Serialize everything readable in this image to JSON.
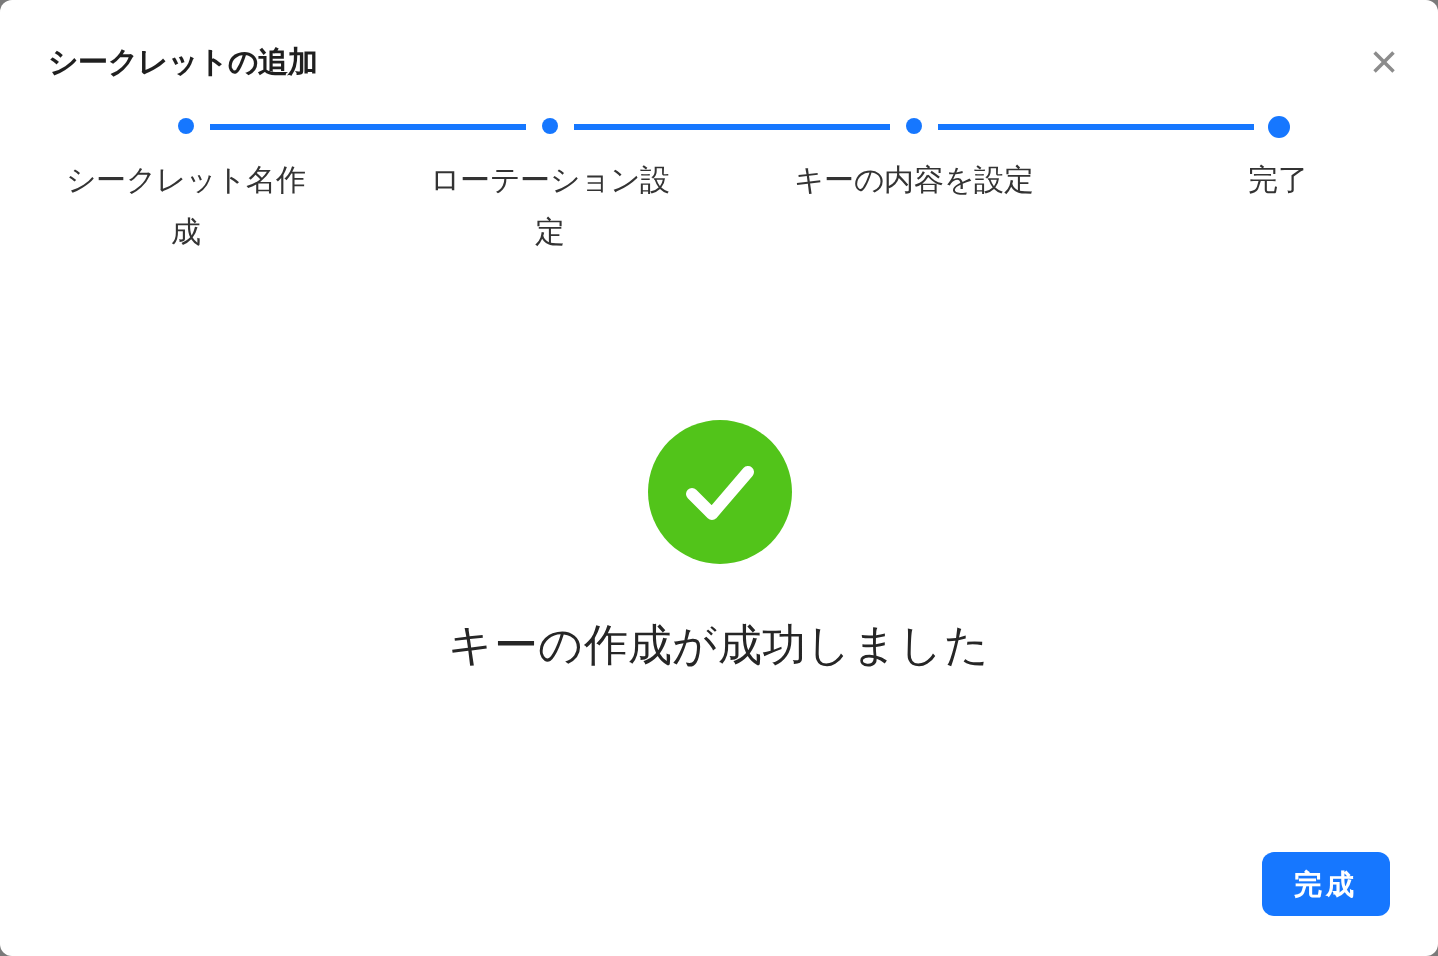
{
  "dialog": {
    "title": "シークレットの追加",
    "close": "×"
  },
  "steps": [
    {
      "label": "シークレット名作成",
      "done": true,
      "selected": false
    },
    {
      "label": "ローテーション設定",
      "done": true,
      "selected": false
    },
    {
      "label": "キーの内容を設定",
      "done": true,
      "selected": false
    },
    {
      "label": "完了",
      "done": false,
      "selected": true
    }
  ],
  "result": {
    "kind": "success",
    "message": "キーの作成が成功しました"
  },
  "buttons": [
    {
      "label": "完成"
    }
  ]
}
